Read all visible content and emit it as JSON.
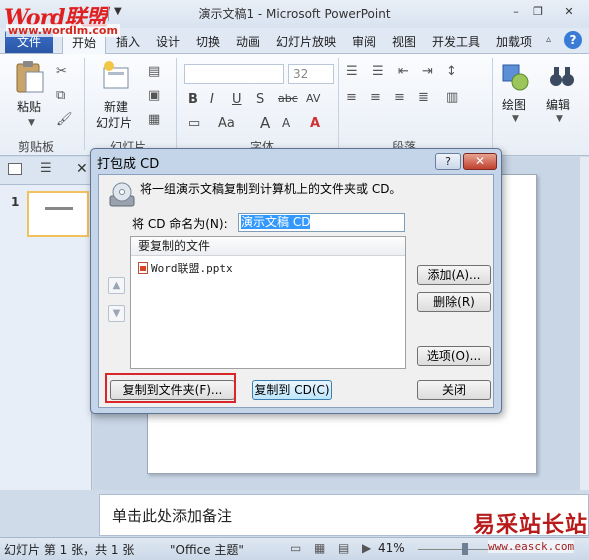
{
  "window": {
    "logo": "Word联盟",
    "logo_url": "www.wordlm.com",
    "title": "演示文稿1 - Microsoft PowerPoint",
    "buttons": [
      "–",
      "❐",
      "✕"
    ]
  },
  "tabs": {
    "file": "文件",
    "home": "开始",
    "others": [
      "插入",
      "设计",
      "切换",
      "动画",
      "幻灯片放映",
      "审阅",
      "视图",
      "开发工具",
      "加载项"
    ],
    "help": "?"
  },
  "ribbon": {
    "clipboard": {
      "paste": "粘贴",
      "label": "剪贴板"
    },
    "slides": {
      "new_slide_1": "新建",
      "new_slide_2": "幻灯片",
      "label": "幻灯片"
    },
    "font": {
      "size": "32",
      "label": "字体",
      "bold": "B",
      "italic": "I",
      "underline": "U",
      "strike": "S",
      "shadow": "abc",
      "spacing": "AV",
      "case": "Aa",
      "grow": "A",
      "shrink": "A"
    },
    "paragraph": {
      "label": "段落"
    },
    "drawing": {
      "label": "绘图"
    },
    "editing": {
      "label": "编辑"
    }
  },
  "left_panel": {
    "slide_number": "1",
    "close": "✕"
  },
  "dialog": {
    "title": "打包成 CD",
    "help": "?",
    "close": "✕",
    "description": "将一组演示文稿复制到计算机上的文件夹或 CD。",
    "name_label": "将 CD 命名为(N):",
    "name_value": "演示文稿 CD",
    "list_header": "要复制的文件",
    "files": [
      "Word联盟.pptx"
    ],
    "add_button": "添加(A)...",
    "delete_button": "删除(R)",
    "options_button": "选项(O)...",
    "copy_folder_button": "复制到文件夹(F)...",
    "copy_cd_button": "复制到 CD(C)",
    "close_button": "关闭"
  },
  "notes": {
    "placeholder": "单击此处添加备注"
  },
  "status": {
    "slide_info": "幻灯片 第 1 张，共 1 张",
    "theme": "\"Office 主题\"",
    "zoom": "41%"
  },
  "watermark": {
    "text": "易采站长站",
    "url": "www.easck.com"
  },
  "colors": {
    "file_tab": "#2a56a6",
    "dialog_close": "#c0402e",
    "highlight_box": "#d8262a",
    "selection": "#3399ff"
  }
}
